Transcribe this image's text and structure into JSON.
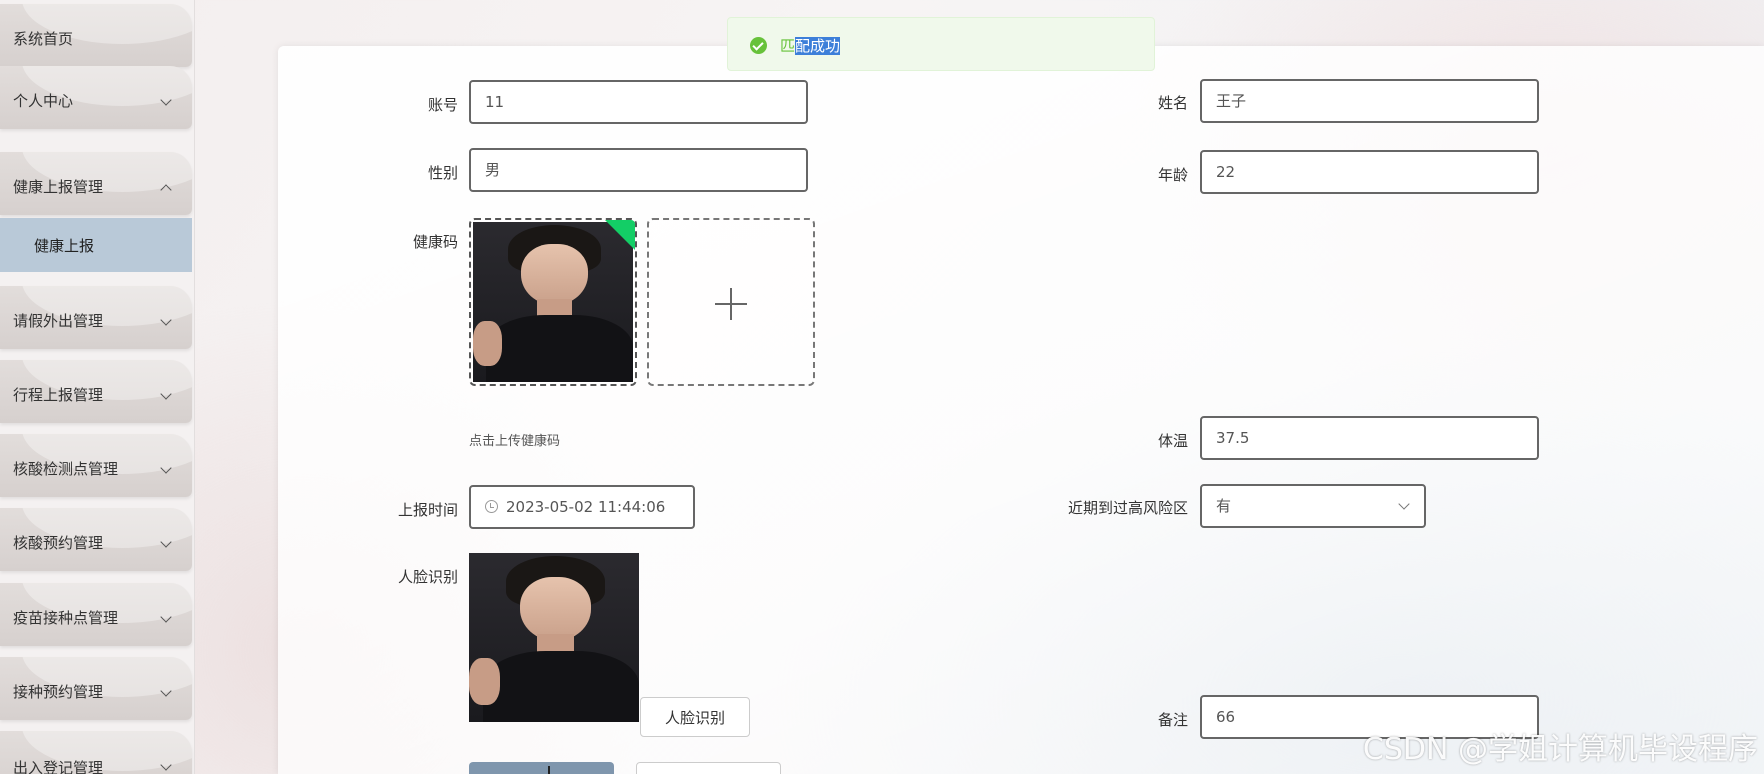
{
  "sidebar": {
    "home": "系统首页",
    "personal_center": "个人中心",
    "health_report_mgmt": "健康上报管理",
    "health_report": "健康上报",
    "leave_mgmt": "请假外出管理",
    "trip_report_mgmt": "行程上报管理",
    "test_site_mgmt": "核酸检测点管理",
    "test_booking_mgmt": "核酸预约管理",
    "vaccine_site_mgmt": "疫苗接种点管理",
    "vaccine_booking_mgmt": "接种预约管理",
    "entry_exit_mgmt": "出入登记管理"
  },
  "toast": {
    "message_prefix": "匹",
    "message_highlight": "配成功"
  },
  "form": {
    "account_label": "账号",
    "account_value": "11",
    "name_label": "姓名",
    "name_value": "王子",
    "gender_label": "性别",
    "gender_value": "男",
    "age_label": "年龄",
    "age_value": "22",
    "health_code_label": "健康码",
    "health_code_hint": "点击上传健康码",
    "temperature_label": "体温",
    "temperature_value": "37.5",
    "report_time_label": "上报时间",
    "report_time_value": "2023-05-02 11:44:06",
    "high_risk_label": "近期到过高风险区",
    "high_risk_value": "有",
    "face_label": "人脸识别",
    "face_button": "人脸识别",
    "remark_label": "备注",
    "remark_value": "66"
  },
  "watermark": "CSDN @学姐计算机毕设程序",
  "icons": {
    "toast": "check-circle-icon",
    "time": "clock-icon",
    "select": "chevron-down-icon",
    "upload": "plus-icon"
  },
  "colors": {
    "success": "#67c23a",
    "submenu_active": "#b9c9d8",
    "primary_button": "#7f96ad"
  }
}
